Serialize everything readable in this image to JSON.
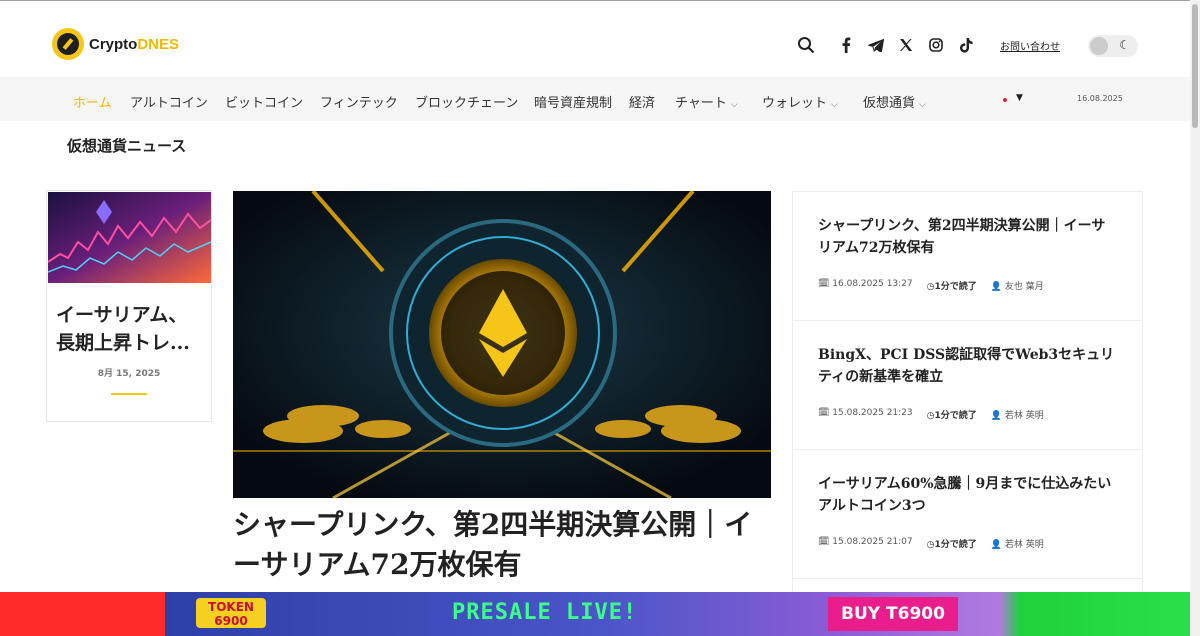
{
  "header": {
    "logo": {
      "prefix": "Crypto",
      "accent": "DNES"
    },
    "icons": [
      "search-icon",
      "facebook-icon",
      "telegram-icon",
      "x-icon",
      "instagram-icon",
      "tiktok-icon"
    ],
    "contact_label": "お問い合わせ",
    "theme_toggle": "dark-mode-toggle"
  },
  "nav": {
    "items": [
      {
        "label": "ホーム",
        "active": true
      },
      {
        "label": "アルトコイン"
      },
      {
        "label": "ビットコイン"
      },
      {
        "label": "フィンテック"
      },
      {
        "label": "ブロックチェーン"
      },
      {
        "label": "暗号資産規制"
      },
      {
        "label": "経済"
      },
      {
        "label": "チャート",
        "dropdown": true
      },
      {
        "label": "ウォレット",
        "dropdown": true
      },
      {
        "label": "仮想通貨",
        "dropdown": true
      }
    ],
    "date": "16.08.2025"
  },
  "main": {
    "section_title": "仮想通貨ニュース",
    "side_card": {
      "title": "イーサリアム、長期上昇トレ...",
      "date": "8月 15, 2025"
    },
    "hero": {
      "title": "シャープリンク、第2四半期決算公開｜イーサリアム72万枚保有"
    },
    "news": [
      {
        "title": "シャープリンク、第2四半期決算公開｜イーサリアム72万枚保有",
        "date": "16.08.2025 13:27",
        "read": "1分で読了",
        "author": "友也 葉月"
      },
      {
        "title": "BingX、PCI DSS認証取得でWeb3セキュリティの新基準を確立",
        "date": "15.08.2025 21:23",
        "read": "1分で読了",
        "author": "若林 英明"
      },
      {
        "title": "イーサリアム60%急騰｜9月までに仕込みたいアルトコイン3つ",
        "date": "15.08.2025 21:07",
        "read": "1分で読了",
        "author": "若林 英明"
      }
    ]
  },
  "banner": {
    "token": "TOKEN 6900",
    "presale": "PRESALE LIVE!",
    "buy": "BUY T6900"
  }
}
